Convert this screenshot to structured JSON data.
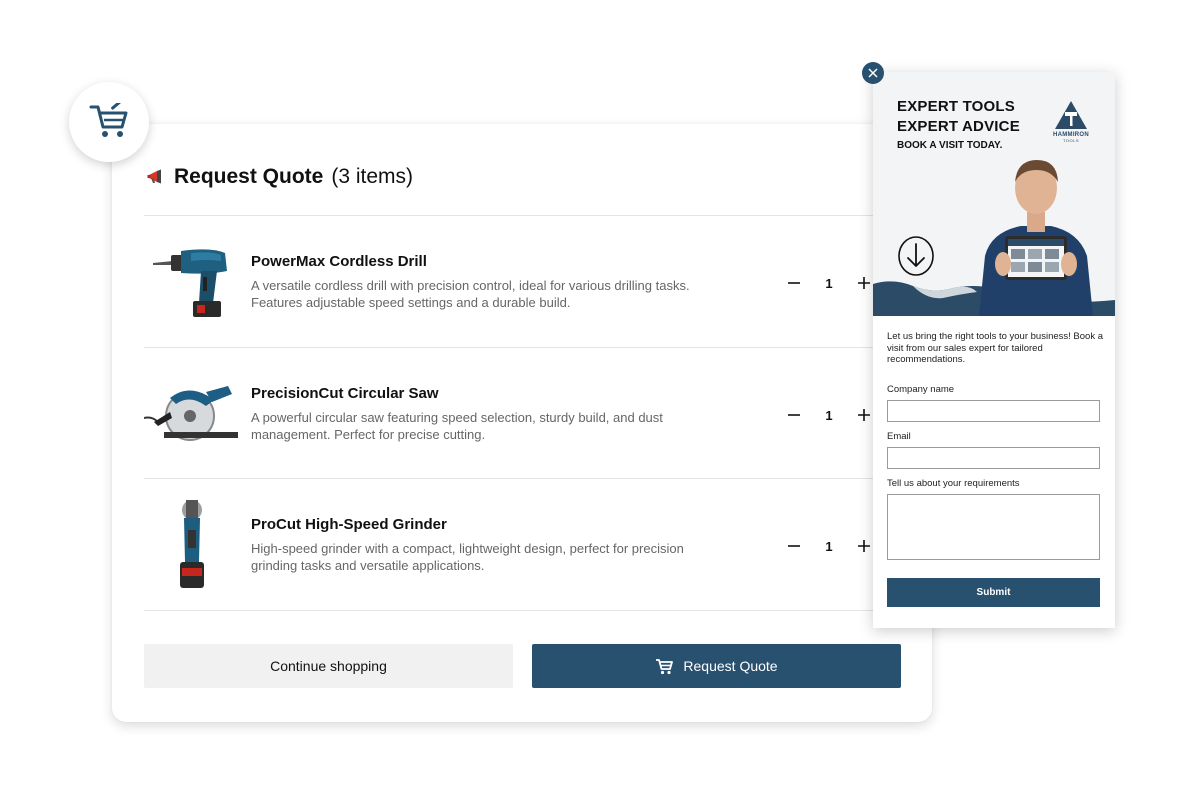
{
  "cart": {
    "icon": "shopping-cart-icon",
    "header": {
      "icon": "megaphone-icon",
      "title": "Request Quote",
      "count": "(3 items)"
    },
    "items": [
      {
        "name": "PowerMax Cordless Drill",
        "description": "A versatile cordless drill with precision control, ideal for various drilling tasks. Features adjustable speed settings and a durable build.",
        "quantity": "1",
        "image": "cordless-drill"
      },
      {
        "name": "PrecisionCut Circular Saw",
        "description": "A powerful circular saw featuring speed selection, sturdy build, and dust management. Perfect for precise cutting.",
        "quantity": "1",
        "image": "circular-saw"
      },
      {
        "name": "ProCut High-Speed Grinder",
        "description": "High-speed grinder with a compact, lightweight design, perfect for precision grinding tasks and versatile applications.",
        "quantity": "1",
        "image": "angle-grinder"
      }
    ],
    "continue_label": "Continue shopping",
    "request_label": "Request Quote"
  },
  "popup": {
    "headline_1": "EXPERT TOOLS",
    "headline_2": "EXPERT ADVICE",
    "subline": "BOOK A VISIT TODAY.",
    "brand": "HAMMIRON",
    "brand_sub": "TOOLS",
    "intro": "Let us bring the right tools to your business! Book a visit from our sales expert for tailored recommendations.",
    "fields": {
      "company_label": "Company name",
      "company_value": "",
      "email_label": "Email",
      "email_value": "",
      "requirements_label": "Tell us about your requirements",
      "requirements_value": ""
    },
    "submit_label": "Submit"
  },
  "colors": {
    "accent": "#28506f",
    "divider": "#e4e4e4",
    "secondary_button": "#f1f1f1"
  }
}
